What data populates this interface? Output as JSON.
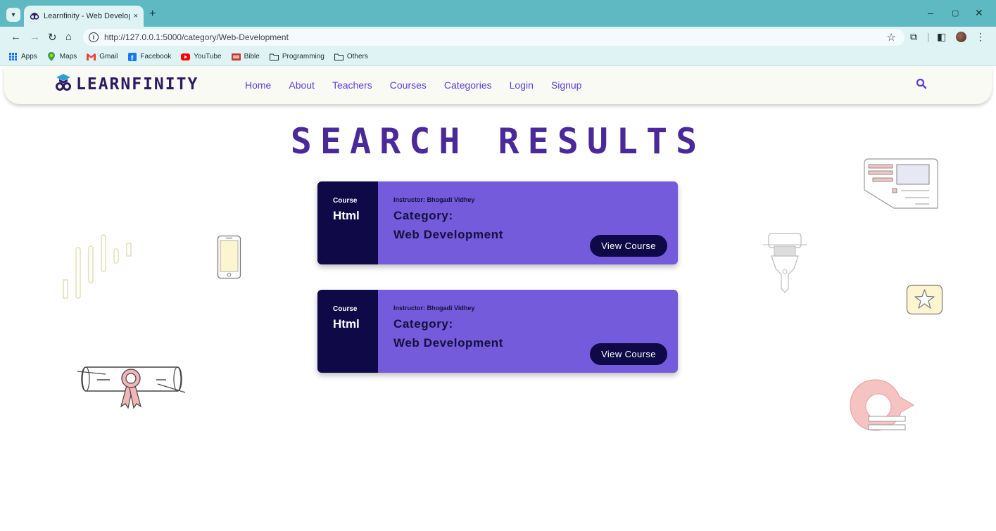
{
  "browser": {
    "tab_title": "Learnfinity - Web Development",
    "tab_close": "×",
    "new_tab": "+",
    "url": "http://127.0.0.1:5000/category/Web-Development",
    "window_controls": {
      "minimize": "–",
      "restore": "▢",
      "close": "✕"
    }
  },
  "bookmarks": [
    {
      "label": "Apps",
      "icon": "apps-grid-icon",
      "color": "#1a73e8"
    },
    {
      "label": "Maps",
      "icon": "maps-pin-icon",
      "color": "#34a853"
    },
    {
      "label": "Gmail",
      "icon": "gmail-icon",
      "color": "#ea4335"
    },
    {
      "label": "Facebook",
      "icon": "facebook-icon",
      "color": "#1877f2"
    },
    {
      "label": "YouTube",
      "icon": "youtube-icon",
      "color": "#ff0000"
    },
    {
      "label": "Bible",
      "icon": "bible-icon",
      "color": "#c0392b"
    },
    {
      "label": "Programming",
      "icon": "folder-icon",
      "color": "#1f2d33"
    },
    {
      "label": "Others",
      "icon": "folder-icon",
      "color": "#1f2d33"
    }
  ],
  "site": {
    "logo_text": "LEARNFINITY",
    "nav": [
      "Home",
      "About",
      "Teachers",
      "Courses",
      "Categories",
      "Login",
      "Signup"
    ],
    "accent": "#5b3ed6"
  },
  "page": {
    "title": "SEARCH RESULTS"
  },
  "results": [
    {
      "kind": "Course",
      "name": "Html",
      "instructor": "Instructor: Bhogadi Vidhey",
      "category_label": "Category:",
      "category": "Web Development",
      "button": "View Course"
    },
    {
      "kind": "Course",
      "name": "Html",
      "instructor": "Instructor: Bhogadi Vidhey",
      "category_label": "Category:",
      "category": "Web Development",
      "button": "View Course"
    }
  ],
  "colors": {
    "card_dark": "#0f0a47",
    "card_purple": "#735bdc",
    "title": "#4a2a9a"
  }
}
